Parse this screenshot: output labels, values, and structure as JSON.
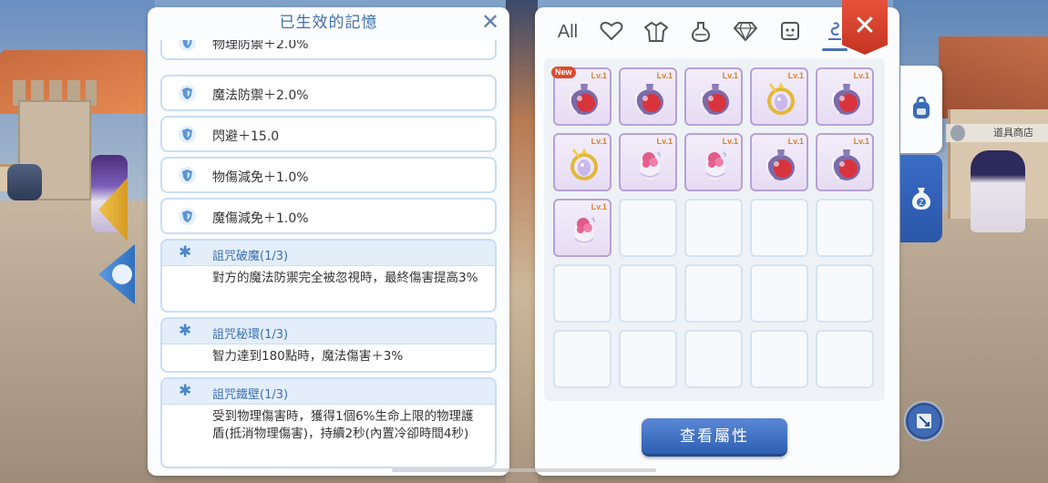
{
  "left_panel": {
    "title": "已生效的記憶",
    "partial_top_text": "物理防禦＋2.0%",
    "stats": [
      {
        "text": "魔法防禦＋2.0%"
      },
      {
        "text": "閃避＋15.0"
      },
      {
        "text": "物傷減免＋1.0%"
      },
      {
        "text": "魔傷減免＋1.0%"
      }
    ],
    "curses": [
      {
        "title": "詛咒破魔(1/3)",
        "desc": "對方的魔法防禦完全被忽視時，最終傷害提高3%"
      },
      {
        "title": "詛咒秘環(1/3)",
        "desc": "智力達到180點時，魔法傷害＋3%"
      },
      {
        "title": "詛咒鐵壁(1/3)",
        "desc": "受到物理傷害時，獲得1個6%生命上限的物理護盾(抵消物理傷害)，持續2秒(內置冷卻時間4秒)"
      }
    ]
  },
  "right_panel": {
    "tabs": [
      {
        "label": "All",
        "icon": "all-text"
      },
      {
        "label": "",
        "icon": "heart-icon"
      },
      {
        "label": "",
        "icon": "armor-icon"
      },
      {
        "label": "",
        "icon": "potion-icon"
      },
      {
        "label": "",
        "icon": "gem-icon"
      },
      {
        "label": "",
        "icon": "card-icon"
      },
      {
        "label": "",
        "icon": "memory-icon"
      }
    ],
    "items": [
      {
        "type": "potion",
        "lv": "Lv.1",
        "new": "New"
      },
      {
        "type": "potion",
        "lv": "Lv.1"
      },
      {
        "type": "potion",
        "lv": "Lv.1"
      },
      {
        "type": "amulet",
        "lv": "Lv.1"
      },
      {
        "type": "potion",
        "lv": "Lv.1"
      },
      {
        "type": "amulet",
        "lv": "Lv.1"
      },
      {
        "type": "bloom",
        "lv": "Lv.1"
      },
      {
        "type": "bloom",
        "lv": "Lv.1"
      },
      {
        "type": "potion",
        "lv": "Lv.1"
      },
      {
        "type": "potion",
        "lv": "Lv.1"
      },
      {
        "type": "bloom",
        "lv": "Lv.1"
      }
    ],
    "grid": {
      "rows": 5,
      "cols": 5
    },
    "view_button": "查看屬性"
  },
  "shop_label": "道具商店",
  "colors": {
    "accent_blue": "#3f6fae",
    "close_red": "#d8402d",
    "lv_orange": "#d9812b",
    "item_border": "#b7a1d6"
  }
}
